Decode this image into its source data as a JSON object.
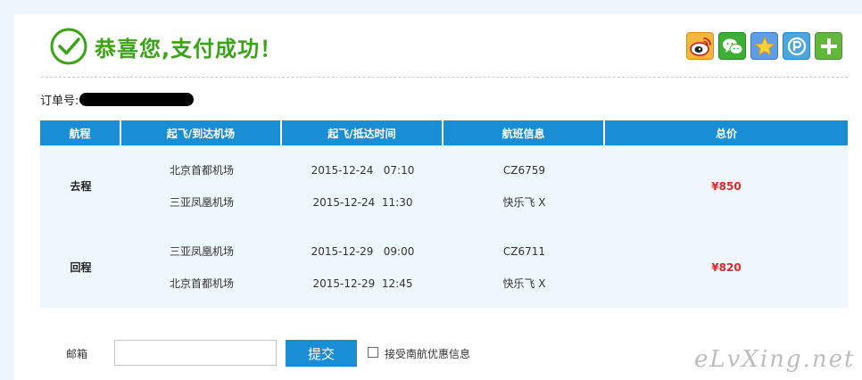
{
  "header": {
    "title": "恭喜您,支付成功！",
    "success_icon": "check-circle-icon",
    "accent_color": "#3aa316"
  },
  "share": [
    {
      "name": "weibo-icon"
    },
    {
      "name": "wechat-icon"
    },
    {
      "name": "qzone-icon"
    },
    {
      "name": "pengyou-icon"
    },
    {
      "name": "more-share-icon"
    }
  ],
  "order": {
    "label": "订单号:"
  },
  "table": {
    "header_color": "#1a8ed4",
    "columns": [
      "航程",
      "起飞/到达机场",
      "起飞/抵达时间",
      "航班信息",
      "总价"
    ],
    "trips": [
      {
        "direction": "去程",
        "airports": [
          "北京首都机场",
          "三亚凤凰机场"
        ],
        "times": [
          "2015-12-24   07:10",
          "2015-12-24  11:30"
        ],
        "flight": [
          "CZ6759",
          "快乐飞 X"
        ],
        "price": "¥850"
      },
      {
        "direction": "回程",
        "airports": [
          "三亚凤凰机场",
          "北京首都机场"
        ],
        "times": [
          "2015-12-29   09:00",
          "2015-12-29  12:45"
        ],
        "flight": [
          "CZ6711",
          "快乐飞 X"
        ],
        "price": "¥820"
      }
    ]
  },
  "form": {
    "email_label": "邮箱",
    "email_value": "",
    "email_placeholder": "",
    "submit_label": "提交",
    "accept_label": "接受南航优惠信息",
    "accept_checked": false
  },
  "watermark": "eLvXing.net"
}
